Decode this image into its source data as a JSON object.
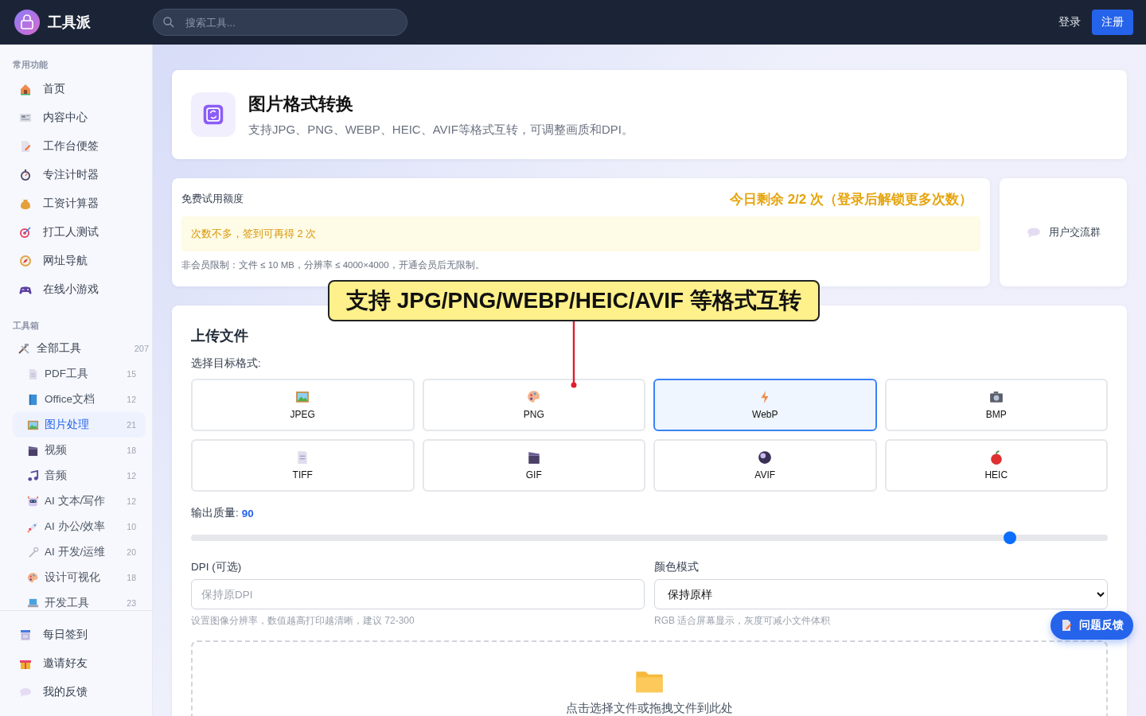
{
  "header": {
    "logo_text": "工具派",
    "search": {
      "placeholder": "搜索工具..."
    },
    "login": "登录",
    "register": "注册"
  },
  "sidebar": {
    "sections": [
      {
        "title": "常用功能",
        "items": [
          {
            "label": "首页"
          },
          {
            "label": "内容中心"
          },
          {
            "label": "工作台便签"
          },
          {
            "label": "专注计时器"
          },
          {
            "label": "工资计算器"
          },
          {
            "label": "打工人测试"
          },
          {
            "label": "网址导航"
          },
          {
            "label": "在线小游戏"
          }
        ]
      },
      {
        "title": "工具箱",
        "items": [
          {
            "label": "全部工具",
            "count": "207",
            "children": [
              {
                "label": "PDF工具",
                "count": "15",
                "selected": false
              },
              {
                "label": "Office文档",
                "count": "12",
                "selected": false
              },
              {
                "label": "图片处理",
                "count": "21",
                "selected": true
              },
              {
                "label": "视频",
                "count": "18",
                "selected": false
              },
              {
                "label": "音频",
                "count": "12",
                "selected": false
              },
              {
                "label": "AI 文本/写作",
                "count": "12",
                "selected": false
              },
              {
                "label": "AI 办公/效率",
                "count": "10",
                "selected": false
              },
              {
                "label": "AI 开发/运维",
                "count": "20",
                "selected": false
              },
              {
                "label": "设计可视化",
                "count": "18",
                "selected": false
              },
              {
                "label": "开发工具",
                "count": "23",
                "selected": false
              }
            ]
          }
        ]
      }
    ],
    "bottom_items": [
      {
        "label": "每日签到"
      },
      {
        "label": "邀请好友"
      },
      {
        "label": "我的反馈"
      }
    ]
  },
  "tool": {
    "title": "图片格式转换",
    "description": "支持JPG、PNG、WEBP、HEIC、AVIF等格式互转，可调整画质和DPI。"
  },
  "quota": {
    "label": "免费试用额度",
    "remaining": "今日剩余 2/2 次（登录后解锁更多次数）",
    "notice": "次数不多，签到可再得 2 次",
    "limit": "非会员限制：文件 ≤ 10 MB，分辨率 ≤ 4000×4000，开通会员后无限制。"
  },
  "community": {
    "label": "用户交流群"
  },
  "callout": {
    "text": "支持 JPG/PNG/WEBP/HEIC/AVIF 等格式互转"
  },
  "upload": {
    "title": "上传文件",
    "format_label": "选择目标格式:",
    "formats": [
      {
        "label": "JPEG",
        "selected": false
      },
      {
        "label": "PNG",
        "selected": false
      },
      {
        "label": "WebP",
        "selected": true
      },
      {
        "label": "BMP",
        "selected": false
      },
      {
        "label": "TIFF",
        "selected": false
      },
      {
        "label": "GIF",
        "selected": false
      },
      {
        "label": "AVIF",
        "selected": false
      },
      {
        "label": "HEIC",
        "selected": false
      }
    ],
    "quality_label": "输出质量:",
    "quality_value": "90",
    "quality": {
      "level": 0.893
    },
    "dpi": {
      "label": "DPI (可选)",
      "placeholder": "保持原DPI",
      "hint": "设置图像分辨率，数值越高打印越清晰，建议 72-300"
    },
    "color_mode": {
      "label": "颜色模式",
      "value": "保持原样",
      "hint": "RGB 适合屏幕显示，灰度可减小文件体积"
    },
    "dropzone": {
      "text": "点击选择文件或拖拽文件到此处"
    }
  },
  "feedback_button": "问题反馈"
}
